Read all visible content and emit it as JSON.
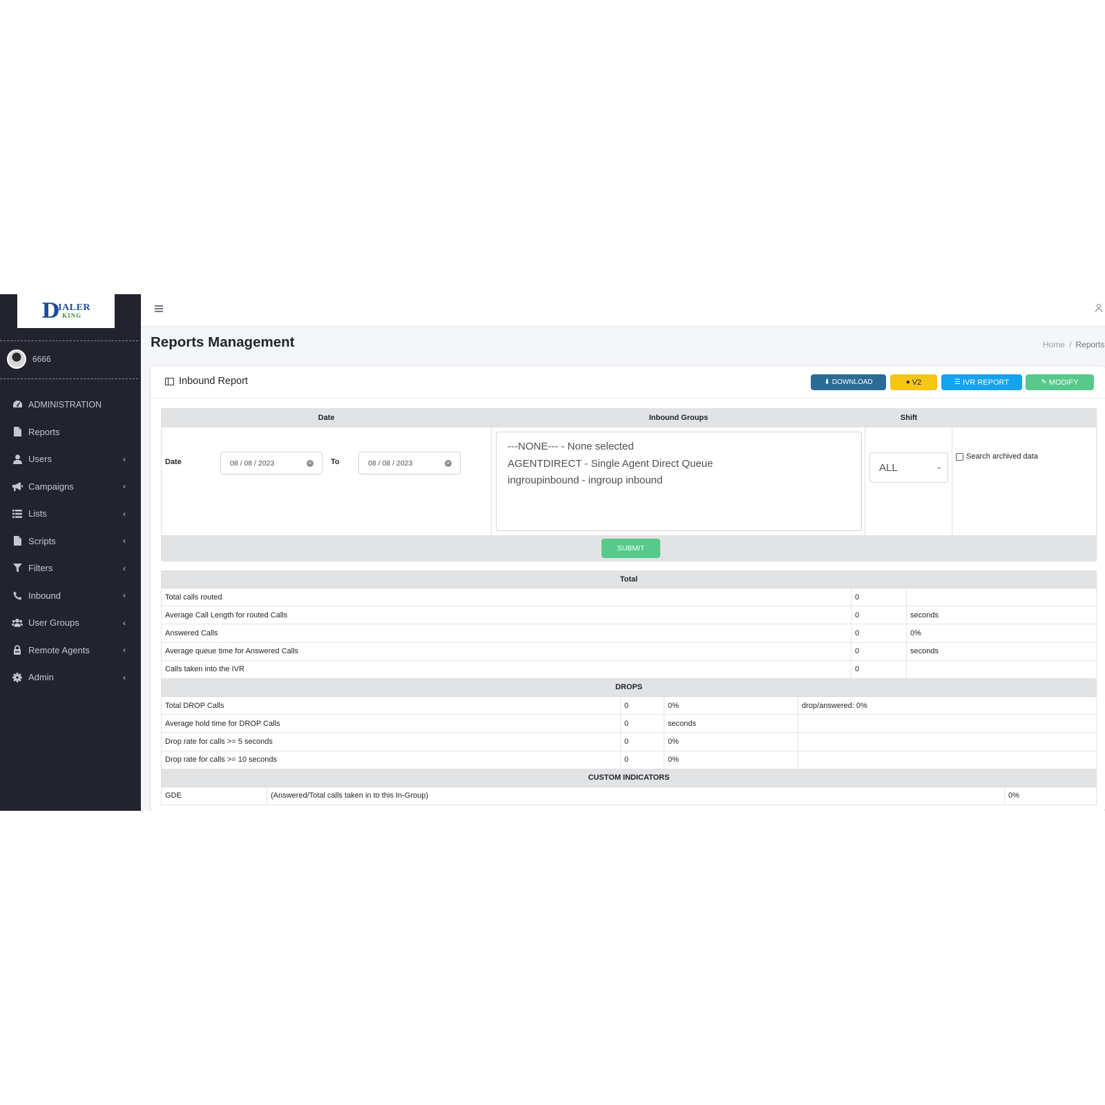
{
  "brand": {
    "logo_mark": "D",
    "logo_top": "IALER",
    "logo_bottom": "KING"
  },
  "user": {
    "name": "6666"
  },
  "sidebar": {
    "items": [
      {
        "label": "ADMINISTRATION",
        "icon": "dashboard-icon",
        "chevron": false
      },
      {
        "label": "Reports",
        "icon": "file-icon",
        "chevron": false
      },
      {
        "label": "Users",
        "icon": "user-icon",
        "chevron": true
      },
      {
        "label": "Campaigns",
        "icon": "bullhorn-icon",
        "chevron": true
      },
      {
        "label": "Lists",
        "icon": "list-icon",
        "chevron": true
      },
      {
        "label": "Scripts",
        "icon": "file-icon",
        "chevron": true
      },
      {
        "label": "Filters",
        "icon": "filter-icon",
        "chevron": true
      },
      {
        "label": "Inbound",
        "icon": "phone-icon",
        "chevron": true
      },
      {
        "label": "User Groups",
        "icon": "users-icon",
        "chevron": true
      },
      {
        "label": "Remote Agents",
        "icon": "lock-icon",
        "chevron": true
      },
      {
        "label": "Admin",
        "icon": "gear-icon",
        "chevron": true
      }
    ]
  },
  "header": {
    "page_title": "Reports Management",
    "breadcrumb_home": "Home",
    "breadcrumb_sep": "/",
    "breadcrumb_current": "Reports"
  },
  "card": {
    "title": "Inbound Report",
    "buttons": {
      "download": "DOWNLOAD",
      "v2": "v2",
      "ivr_report": "IVR REPORT",
      "modify": "MODIFY"
    }
  },
  "colors": {
    "download": "#2c6b95",
    "v2": "#f5c518",
    "ivr": "#15a3f0",
    "modify": "#56c98b",
    "sidebar": "#22232f"
  },
  "filters": {
    "col_date": "Date",
    "col_inbound_groups": "Inbound Groups",
    "col_shift": "Shift",
    "date_label": "Date",
    "date_from": "08 / 08 / 2023",
    "to_label": "To",
    "date_to": "08 / 08 / 2023",
    "inbound_groups": [
      "---NONE--- - None selected",
      "AGENTDIRECT - Single Agent Direct Queue",
      "ingroupinbound - ingroup inbound"
    ],
    "shift_value": "ALL",
    "archived_label": "Search archived data",
    "submit": "SUBMIT"
  },
  "results": {
    "total_header": "Total",
    "total_rows": [
      [
        "Total calls routed",
        "0",
        ""
      ],
      [
        "Average Call Length for routed Calls",
        "0",
        "seconds"
      ],
      [
        "Answered Calls",
        "0",
        "0%"
      ],
      [
        "Average queue time for Answered Calls",
        "0",
        "seconds"
      ],
      [
        "Calls taken into the IVR",
        "0",
        ""
      ]
    ],
    "drops_header": "DROPS",
    "drop_rows": [
      [
        "Total DROP Calls",
        "0",
        "0%",
        "drop/answered: 0%"
      ],
      [
        "Average hold time for DROP Calls",
        "0",
        "seconds",
        ""
      ],
      [
        "Drop rate for calls >= 5 seconds",
        "0",
        "0%",
        ""
      ],
      [
        "Drop rate for calls >= 10 seconds",
        "0",
        "0%",
        ""
      ]
    ],
    "custom_header": "CUSTOM INDICATORS",
    "custom_rows": [
      [
        "GDE",
        "(Answered/Total calls taken in to this In-Group)",
        "0%"
      ]
    ]
  }
}
